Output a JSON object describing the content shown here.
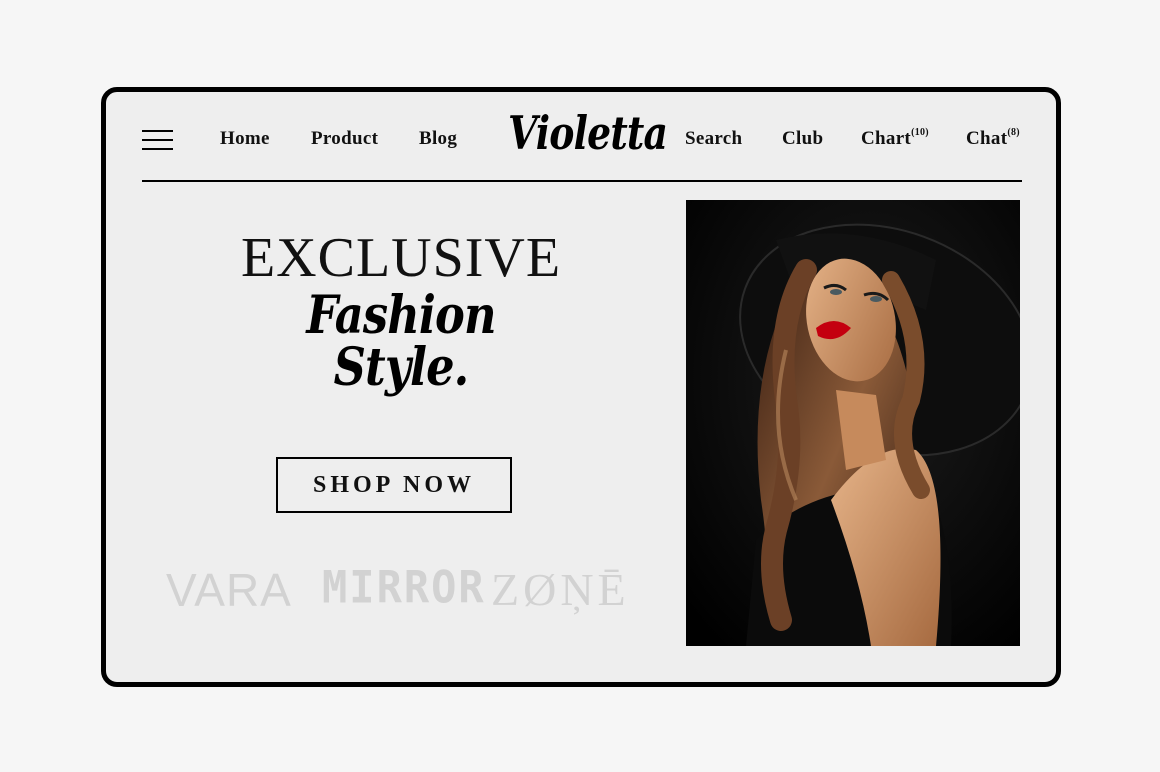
{
  "header": {
    "menu_icon": "hamburger-icon",
    "nav_left": [
      "Home",
      "Product",
      "Blog"
    ],
    "logo": "Violetta",
    "nav_right": [
      {
        "label": "Search",
        "count": ""
      },
      {
        "label": "Club",
        "count": ""
      },
      {
        "label": "Chart",
        "count": "(10)"
      },
      {
        "label": "Chat",
        "count": "(8)"
      }
    ]
  },
  "hero": {
    "headline": "EXCLUSIVE",
    "tagline": "Fashion Style.",
    "cta": "SHOP NOW",
    "brands": [
      "VARA",
      "MIRROR",
      "ZØŅĒ"
    ]
  },
  "colors": {
    "frame": "#000000",
    "card_background": "#eeeeee",
    "page_background": "#f6f6f6",
    "brand_logo": "#d2d2d2",
    "lip_accent": "#c4000f"
  }
}
